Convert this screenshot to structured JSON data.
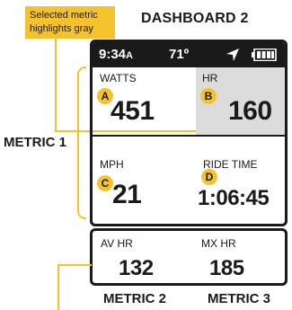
{
  "callout": {
    "line1": "Selected metric",
    "line2": "highlights gray"
  },
  "dashboard_title": "DASHBOARD 2",
  "labels": {
    "metric1": "METRIC 1",
    "metric2": "METRIC 2",
    "metric3": "METRIC 3"
  },
  "status": {
    "time": "9:34",
    "ampm": "A",
    "temperature": "71º",
    "icons": [
      "navigation-arrow-icon",
      "battery-icon"
    ]
  },
  "metrics": {
    "watts": {
      "label": "WATTS",
      "value": "451",
      "badge": "A"
    },
    "hr": {
      "label": "HR",
      "value": "160",
      "badge": "B"
    },
    "mph": {
      "label": "MPH",
      "value": "21",
      "badge": "C"
    },
    "ride_time": {
      "label": "RIDE TIME",
      "value": "1:06:45",
      "badge": "D"
    }
  },
  "lower": {
    "av_hr": {
      "label": "AV HR",
      "value": "132"
    },
    "mx_hr": {
      "label": "MX HR",
      "value": "185"
    }
  },
  "colors": {
    "accent": "#f6c22c",
    "highlight": "#dcdcdc",
    "ink": "#1a1a1a"
  }
}
